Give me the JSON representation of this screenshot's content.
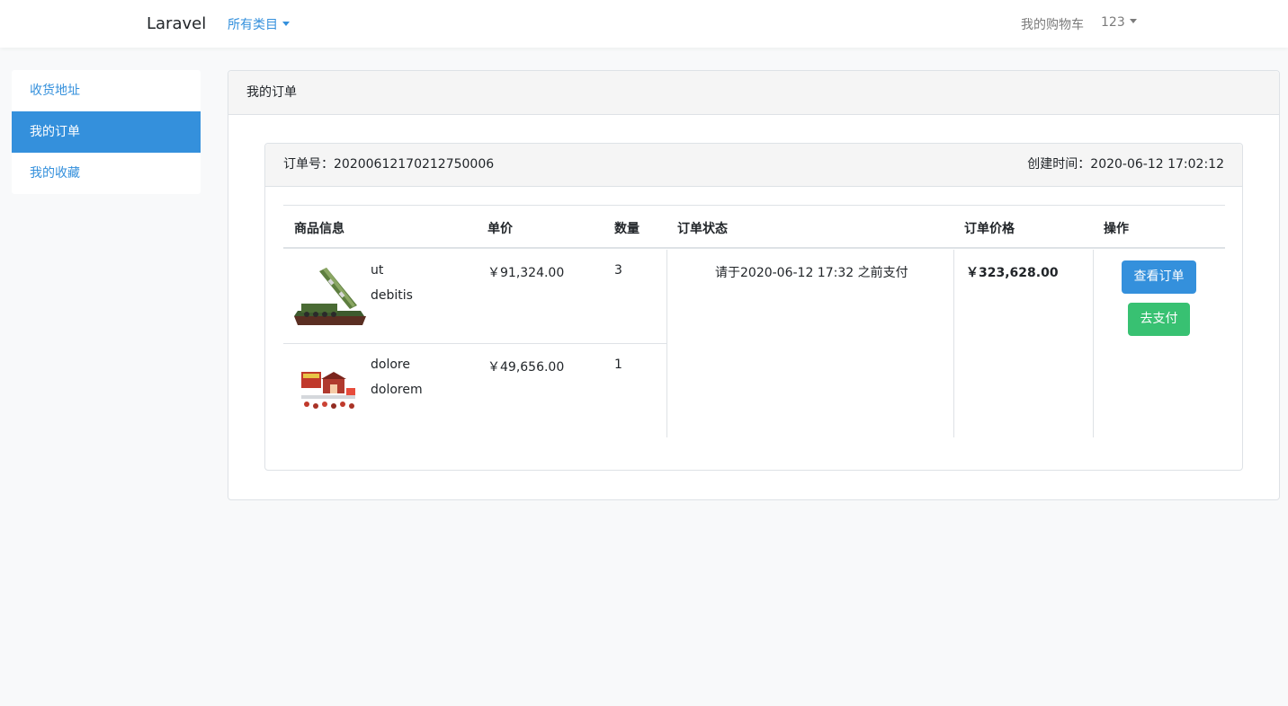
{
  "navbar": {
    "brand": "Laravel",
    "category_label": "所有类目",
    "cart_label": "我的购物车",
    "user_label": "123"
  },
  "sidebar": {
    "items": [
      {
        "label": "收货地址",
        "active": false
      },
      {
        "label": "我的订单",
        "active": true
      },
      {
        "label": "我的收藏",
        "active": false
      }
    ]
  },
  "panel": {
    "title": "我的订单"
  },
  "order": {
    "number_label": "订单号：",
    "number": "20200612170212750006",
    "created_label": "创建时间：",
    "created_at": "2020-06-12 17:02:12",
    "columns": [
      "商品信息",
      "单价",
      "数量",
      "订单状态",
      "订单价格",
      "操作"
    ],
    "items": [
      {
        "title": "ut",
        "sku": "debitis",
        "price": "￥91,324.00",
        "qty": "3",
        "image": "missile-model-icon"
      },
      {
        "title": "dolore",
        "sku": "dolorem",
        "price": "￥49,656.00",
        "qty": "1",
        "image": "brick-set-icon"
      }
    ],
    "status": "请于2020-06-12 17:32 之前支付",
    "total": "￥323,628.00",
    "actions": {
      "view": "查看订单",
      "pay": "去支付"
    }
  },
  "colors": {
    "primary": "#3490dc",
    "success": "#38c172",
    "page_bg": "#f8f9fa"
  }
}
